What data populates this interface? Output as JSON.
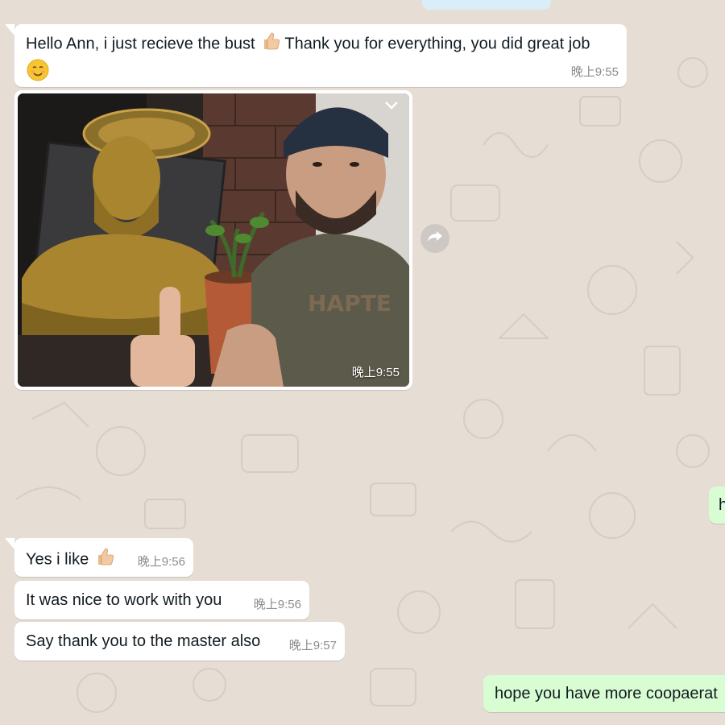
{
  "messages": {
    "hello": {
      "text": "Hello Ann, i just recieve the bust",
      "text2": "Thank you for everything, you did great job",
      "time": "晚上9:55"
    },
    "photo": {
      "time": "晚上9:55"
    },
    "outgoing_partial": {
      "text": "h"
    },
    "yes_like": {
      "text": "Yes i like",
      "time": "晚上9:56"
    },
    "nice_work": {
      "text": "It was nice to work with you",
      "time": "晚上9:56"
    },
    "say_thanks": {
      "text": "Say thank you to the master also",
      "time": "晚上9:57"
    },
    "hope": {
      "text": "hope you have more coopaerat"
    }
  },
  "colors": {
    "background": "#e6ddd4",
    "incoming_bubble": "#ffffff",
    "outgoing_bubble": "#d9fdd3",
    "timestamp": "#8c8c8c"
  },
  "icons": [
    "thumbs-up-icon",
    "smiling-face-icon",
    "chevron-down-icon",
    "forward-icon"
  ]
}
